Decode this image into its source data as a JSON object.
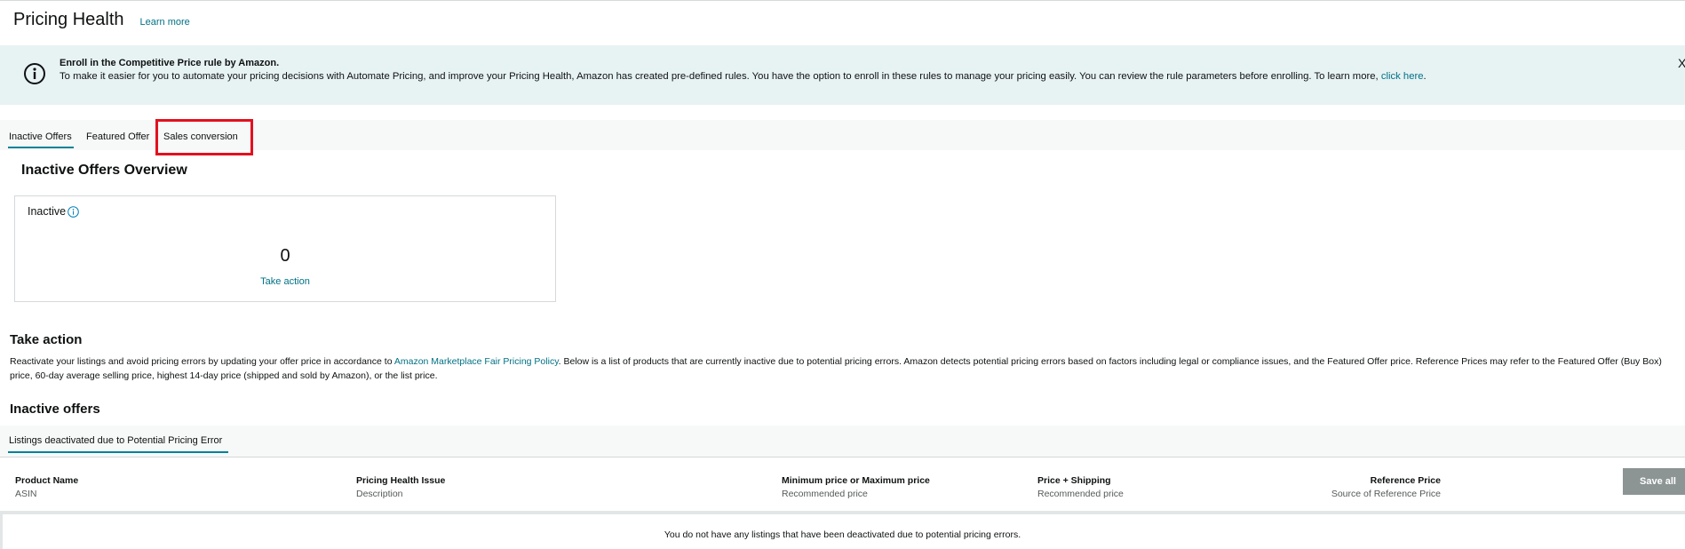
{
  "header": {
    "title": "Pricing Health",
    "learn_more": "Learn more"
  },
  "banner": {
    "icon": "info-circle-icon",
    "title": "Enroll in the Competitive Price rule by Amazon.",
    "text": "To make it easier for you to automate your pricing decisions with Automate Pricing, and improve your Pricing Health, Amazon has created pre-defined rules. You have the option to enroll in these rules to manage your pricing easily. You can review the rule parameters before enrolling. To learn more, ",
    "link": "click here",
    "text_end": ".",
    "close": "X"
  },
  "tabs": [
    {
      "label": "Inactive Offers",
      "active": true
    },
    {
      "label": "Featured Offer",
      "active": false
    },
    {
      "label": "Sales conversion",
      "active": false,
      "highlighted": true
    }
  ],
  "overview": {
    "title": "Inactive Offers Overview",
    "card": {
      "label": "Inactive",
      "icon": "info-icon",
      "count": "0",
      "action": "Take action"
    }
  },
  "take_action": {
    "title": "Take action",
    "text_before": "Reactivate your listings and avoid pricing errors by updating your offer price in accordance to ",
    "link": "Amazon Marketplace Fair Pricing Policy",
    "text_after": ". Below is a list of products that are currently inactive due to potential pricing errors. Amazon detects potential pricing errors based on factors including legal or compliance issues, and the Featured Offer price. Reference Prices may refer to the Featured Offer (Buy Box) price, 60-day average selling price, highest 14-day price (shipped and sold by Amazon), or the list price."
  },
  "inactive_offers": {
    "title": "Inactive offers",
    "subtab": "Listings deactivated due to Potential Pricing Error",
    "columns": [
      {
        "header": "Product Name",
        "sub": "ASIN"
      },
      {
        "header": "Pricing Health Issue",
        "sub": "Description"
      },
      {
        "header": "Minimum price or Maximum price",
        "sub": "Recommended price"
      },
      {
        "header": "Price + Shipping",
        "sub": "Recommended price"
      },
      {
        "header": "Reference Price",
        "sub": "Source of Reference Price"
      }
    ],
    "save_all": "Save all",
    "empty_message": "You do not have any listings that have been deactivated due to potential pricing errors."
  },
  "colors": {
    "accent": "#008296",
    "link": "#007185",
    "banner_bg": "#e7f2f3",
    "highlight": "#e3101e"
  }
}
